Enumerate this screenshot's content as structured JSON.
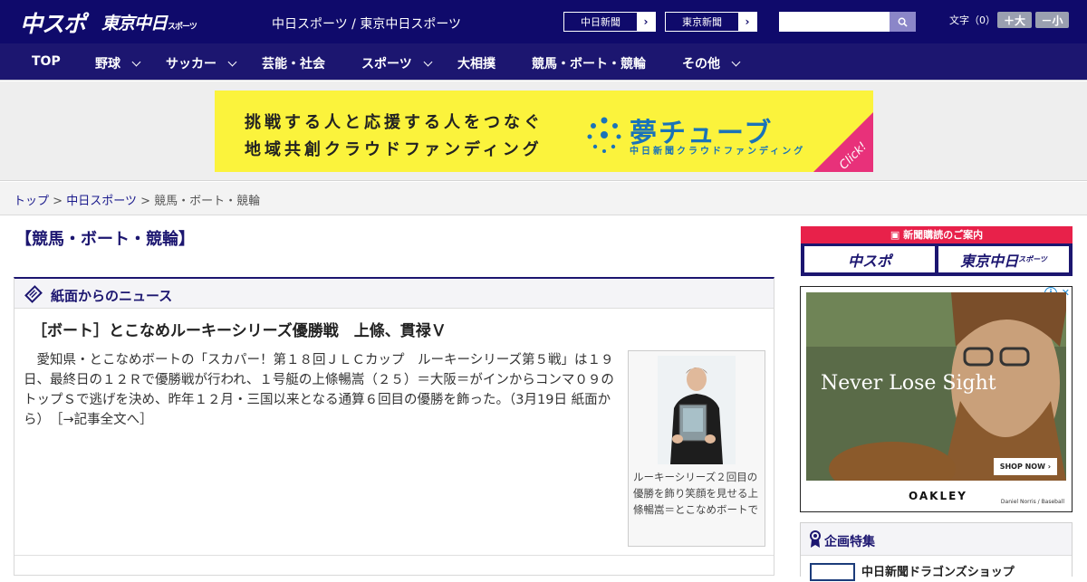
{
  "header": {
    "logo_main": "中スポ",
    "logo_tokyo": "東京中日",
    "logo_tokyo_small": "スポーツ",
    "site_title": "中日スポーツ / 東京中日スポーツ",
    "ext_links": [
      "中日新聞",
      "東京新聞"
    ],
    "ext_arrow": "›",
    "font_size_label": "文字（0）",
    "font_up": "＋大",
    "font_down": "－小"
  },
  "nav": {
    "items": [
      {
        "label": "TOP",
        "has_menu": false
      },
      {
        "label": "野球",
        "has_menu": true
      },
      {
        "label": "サッカー",
        "has_menu": true
      },
      {
        "label": "芸能・社会",
        "has_menu": false
      },
      {
        "label": "スポーツ",
        "has_menu": true
      },
      {
        "label": "大相撲",
        "has_menu": false
      },
      {
        "label": "競馬・ボート・競輪",
        "has_menu": false
      },
      {
        "label": "その他",
        "has_menu": true
      }
    ]
  },
  "banner": {
    "line1": "挑戦する人と応援する人をつなぐ",
    "line2": "地域共創クラウドファンディング",
    "brand": "夢チューブ",
    "brand_sub": "中日新聞クラウドファンディング",
    "click": "Click!"
  },
  "breadcrumb": {
    "home": "トップ",
    "section": "中日スポーツ",
    "current": "競馬・ボート・競輪",
    "sep": ">"
  },
  "main": {
    "category_title": "【競馬・ボート・競輪】",
    "news_section_title": "紙面からのニュース",
    "article": {
      "title": "［ボート］とこなめルーキーシリーズ優勝戦　上條、貫禄Ｖ",
      "body": "愛知県・とこなめボートの「スカパー！第１８回ＪＬＣカップ　ルーキーシリーズ第５戦」は１９日、最終日の１２Ｒで優勝戦が行われ、１号艇の上條暢嵩（２５）＝大阪＝がインからコンマ０９のトップＳで逃げを決め、昨年１２月・三国以来となる通算６回目の優勝を飾った。（3月19日 紙面から）",
      "more": "［→記事全文へ］",
      "photo_caption": "ルーキーシリーズ２回目の優勝を飾り笑顔を見せる上條暢嵩＝とこなめボートで"
    }
  },
  "sidebar": {
    "subscription_head": "新聞購読のご案内",
    "sub_chuspo": "中スポ",
    "sub_tokyo": "東京中日",
    "sub_tokyo_small": "スポーツ",
    "ad_text": "Never Lose Sight",
    "ad_shop": "SHOP NOW ›",
    "ad_logo": "OAKLEY",
    "ad_credit": "Daniel Norris / Baseball",
    "ad_info": "i",
    "feature_title": "企画特集",
    "feature_item": "中日新聞ドラゴンズショップ"
  }
}
